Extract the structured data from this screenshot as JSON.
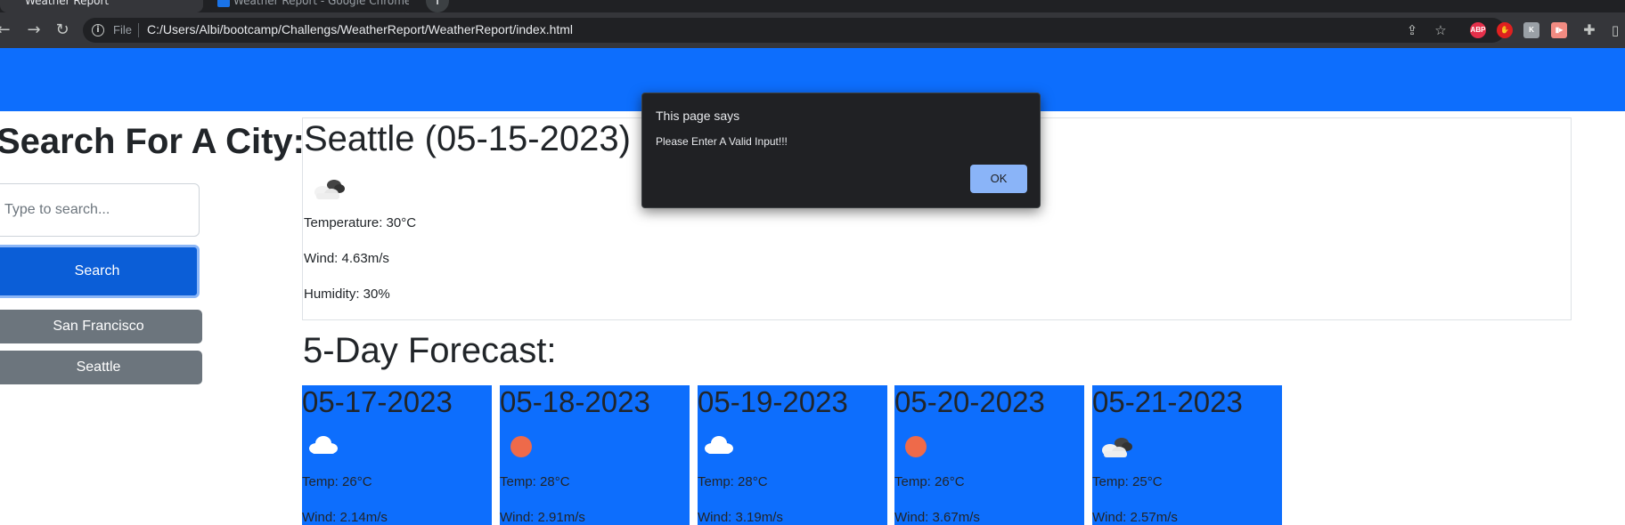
{
  "browser": {
    "tabs": [
      {
        "label": "Weather Report"
      },
      {
        "label": "Weather Report - Google Chrome"
      }
    ],
    "url_scheme": "File",
    "url": "C:/Users/Albi/bootcamp/Challengs/WeatherReport/WeatherReport/index.html",
    "extensions": [
      {
        "name": "adblock-icon",
        "text": "ABP",
        "color": "#e5304b"
      },
      {
        "name": "hand-stop-icon",
        "text": "✋",
        "color": "#e0201f"
      },
      {
        "name": "extension-k-icon",
        "text": "K",
        "color": "#9aa0a6"
      },
      {
        "name": "extension-camera-icon",
        "text": "▮▸",
        "color": "#f28b82"
      }
    ]
  },
  "search": {
    "title": "Search For A City:",
    "placeholder": "Type to search...",
    "button_label": "Search",
    "history": [
      "San Francisco",
      "Seattle"
    ]
  },
  "current": {
    "city_date": "Seattle (05-15-2023)",
    "icon": "broken-clouds-icon",
    "temperature": "Temperature: 30°C",
    "wind": "Wind: 4.63m/s",
    "humidity": "Humidity: 30%"
  },
  "forecast": {
    "title": "5-Day Forecast:",
    "days": [
      {
        "date": "05-17-2023",
        "icon": "cloud-icon",
        "temp": "Temp: 26°C",
        "wind": "Wind: 2.14m/s"
      },
      {
        "date": "05-18-2023",
        "icon": "sun-icon",
        "temp": "Temp: 28°C",
        "wind": "Wind: 2.91m/s"
      },
      {
        "date": "05-19-2023",
        "icon": "cloud-icon",
        "temp": "Temp: 28°C",
        "wind": "Wind: 3.19m/s"
      },
      {
        "date": "05-20-2023",
        "icon": "sun-icon",
        "temp": "Temp: 26°C",
        "wind": "Wind: 3.67m/s"
      },
      {
        "date": "05-21-2023",
        "icon": "broken-clouds-icon",
        "temp": "Temp: 25°C",
        "wind": "Wind: 2.57m/s"
      }
    ]
  },
  "alert": {
    "title": "This page says",
    "message": "Please Enter A Valid Input!!!",
    "ok_label": "OK"
  },
  "colors": {
    "header": "#0d6efd",
    "card": "#0d6efd",
    "history_button": "#6c757d",
    "search_button": "#0b5ed7",
    "sun": "#ee6a4a"
  }
}
